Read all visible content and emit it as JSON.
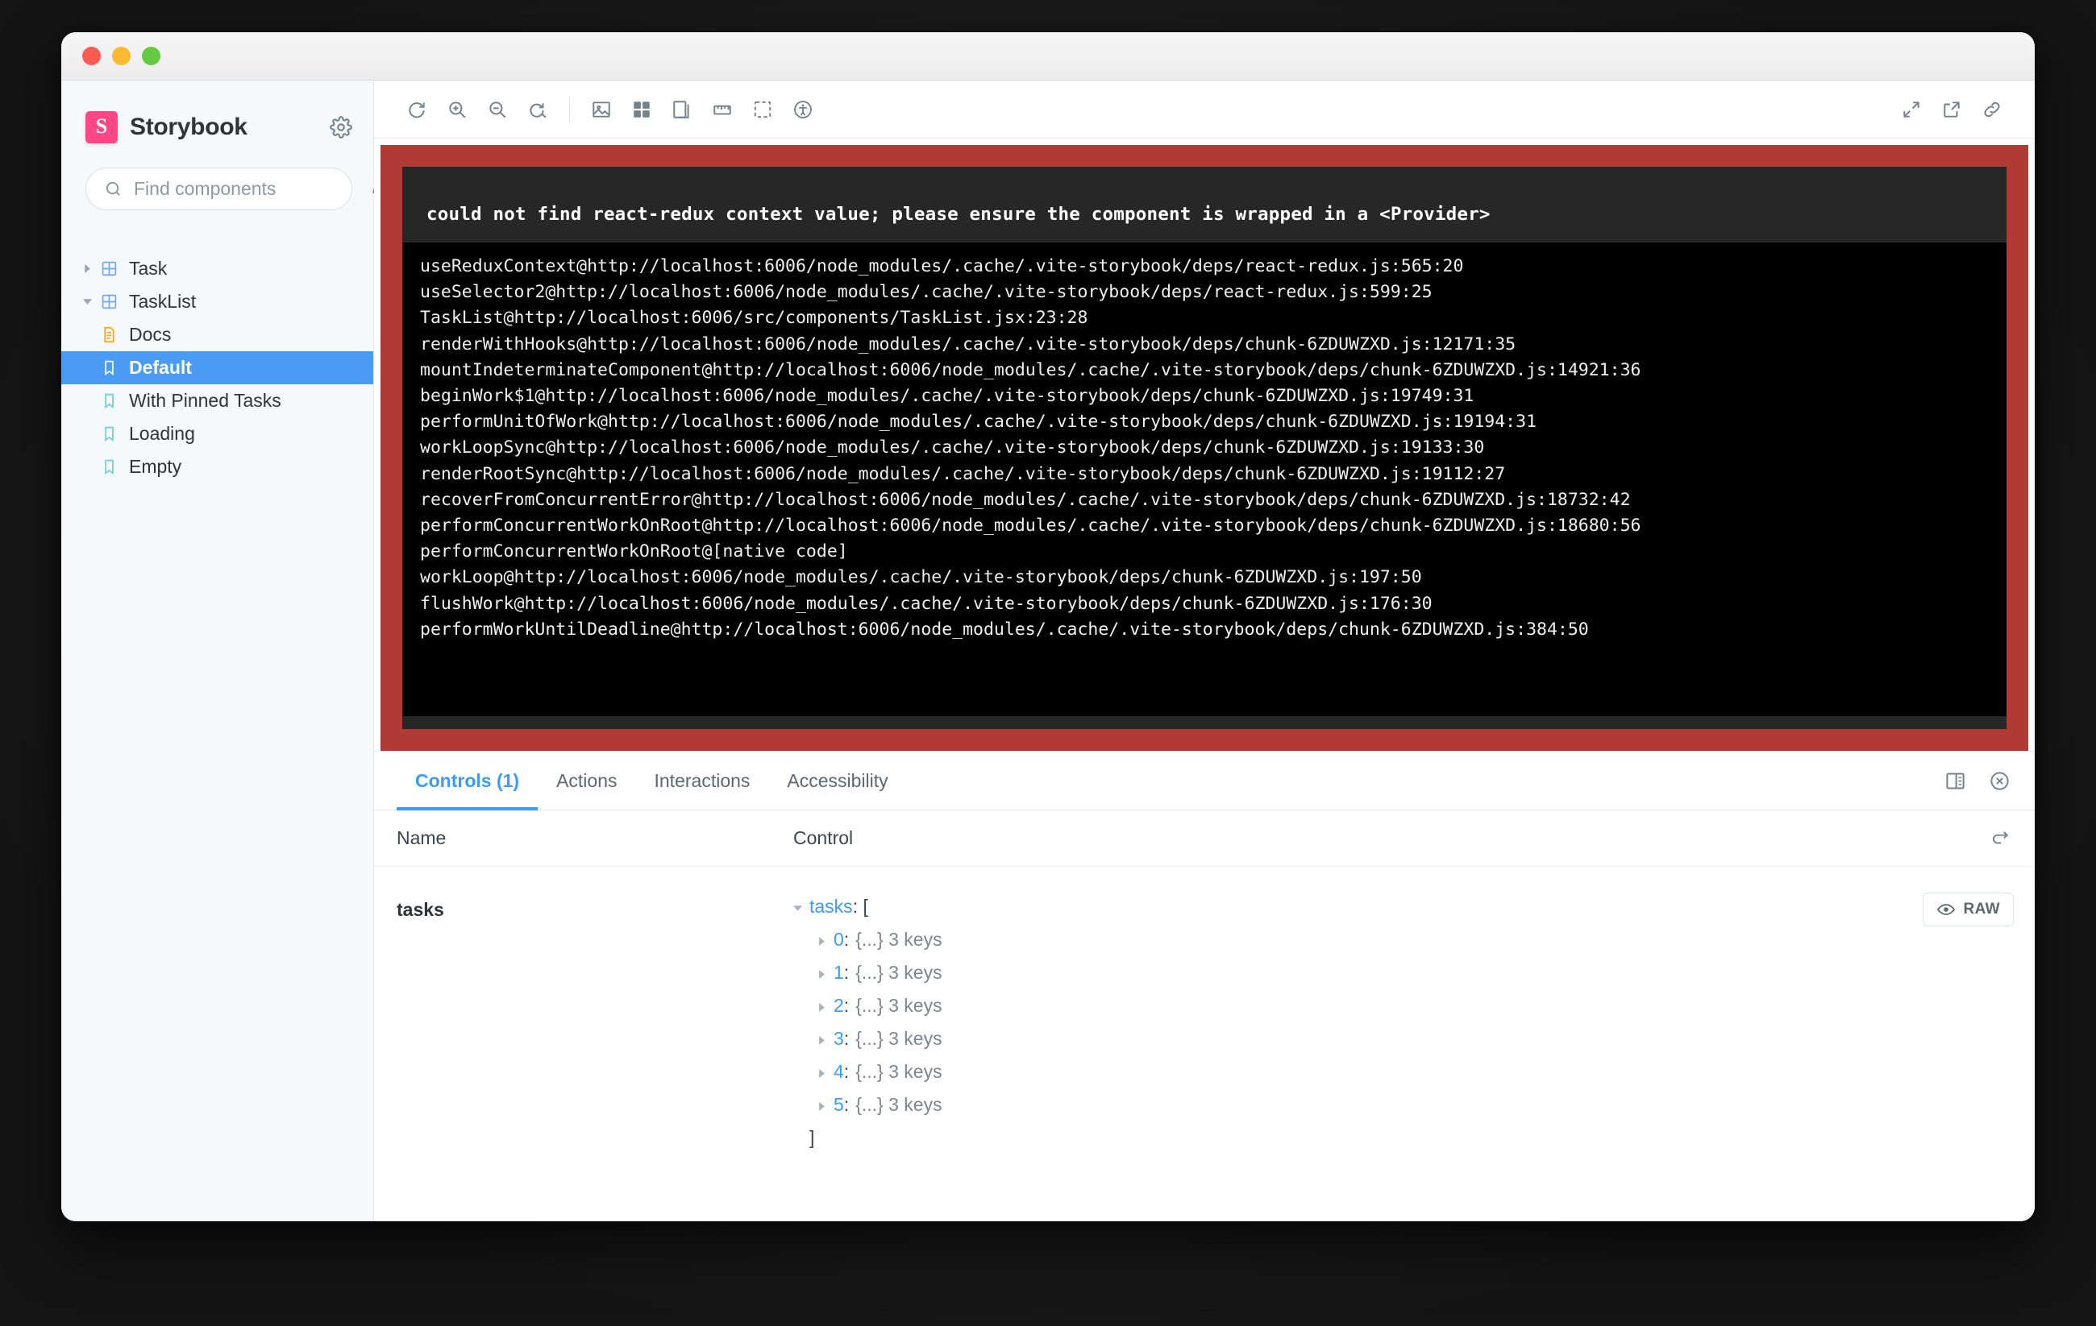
{
  "window": {
    "traffic_lights": [
      "close",
      "minimize",
      "zoom"
    ]
  },
  "sidebar": {
    "brand": "Storybook",
    "logo_letter": "S",
    "settings_icon": "gear-icon",
    "search": {
      "placeholder": "Find components",
      "value": "",
      "shortcut": "/",
      "icon": "search-icon"
    },
    "tree": [
      {
        "label": "Task",
        "icon": "component-icon",
        "depth": 0,
        "caret": "closed",
        "selected": false
      },
      {
        "label": "TaskList",
        "icon": "component-icon",
        "depth": 0,
        "caret": "open",
        "selected": false
      },
      {
        "label": "Docs",
        "icon": "docs-icon",
        "depth": 1,
        "caret": "none",
        "selected": false
      },
      {
        "label": "Default",
        "icon": "story-icon",
        "depth": 1,
        "caret": "none",
        "selected": true
      },
      {
        "label": "With Pinned Tasks",
        "icon": "story-icon",
        "depth": 1,
        "caret": "none",
        "selected": false
      },
      {
        "label": "Loading",
        "icon": "story-icon",
        "depth": 1,
        "caret": "none",
        "selected": false
      },
      {
        "label": "Empty",
        "icon": "story-icon",
        "depth": 1,
        "caret": "none",
        "selected": false
      }
    ]
  },
  "toolbar": {
    "left_icons": [
      "remount-icon",
      "zoom-in-icon",
      "zoom-out-icon",
      "zoom-reset-icon"
    ],
    "tool_icons": [
      "background-image-icon",
      "grid-icon",
      "viewport-icon",
      "measure-icon",
      "outline-icon",
      "accessibility-icon"
    ],
    "right_icons": [
      "fullscreen-icon",
      "open-in-new-tab-icon",
      "copy-link-icon"
    ]
  },
  "preview": {
    "error_title": "could not find react-redux context value; please ensure the component is wrapped in a <Provider>",
    "stack": "useReduxContext@http://localhost:6006/node_modules/.cache/.vite-storybook/deps/react-redux.js:565:20\nuseSelector2@http://localhost:6006/node_modules/.cache/.vite-storybook/deps/react-redux.js:599:25\nTaskList@http://localhost:6006/src/components/TaskList.jsx:23:28\nrenderWithHooks@http://localhost:6006/node_modules/.cache/.vite-storybook/deps/chunk-6ZDUWZXD.js:12171:35\nmountIndeterminateComponent@http://localhost:6006/node_modules/.cache/.vite-storybook/deps/chunk-6ZDUWZXD.js:14921:36\nbeginWork$1@http://localhost:6006/node_modules/.cache/.vite-storybook/deps/chunk-6ZDUWZXD.js:19749:31\nperformUnitOfWork@http://localhost:6006/node_modules/.cache/.vite-storybook/deps/chunk-6ZDUWZXD.js:19194:31\nworkLoopSync@http://localhost:6006/node_modules/.cache/.vite-storybook/deps/chunk-6ZDUWZXD.js:19133:30\nrenderRootSync@http://localhost:6006/node_modules/.cache/.vite-storybook/deps/chunk-6ZDUWZXD.js:19112:27\nrecoverFromConcurrentError@http://localhost:6006/node_modules/.cache/.vite-storybook/deps/chunk-6ZDUWZXD.js:18732:42\nperformConcurrentWorkOnRoot@http://localhost:6006/node_modules/.cache/.vite-storybook/deps/chunk-6ZDUWZXD.js:18680:56\nperformConcurrentWorkOnRoot@[native code]\nworkLoop@http://localhost:6006/node_modules/.cache/.vite-storybook/deps/chunk-6ZDUWZXD.js:197:50\nflushWork@http://localhost:6006/node_modules/.cache/.vite-storybook/deps/chunk-6ZDUWZXD.js:176:30\nperformWorkUntilDeadline@http://localhost:6006/node_modules/.cache/.vite-storybook/deps/chunk-6ZDUWZXD.js:384:50",
    "frame_color": "#b03a36",
    "panel_color": "#272727",
    "stack_bg": "#000000"
  },
  "addons": {
    "tabs": [
      {
        "label": "Controls (1)",
        "active": true
      },
      {
        "label": "Actions",
        "active": false
      },
      {
        "label": "Interactions",
        "active": false
      },
      {
        "label": "Accessibility",
        "active": false
      }
    ],
    "panel_icons": [
      "layout-position-icon",
      "close-panel-icon"
    ],
    "table": {
      "columns": {
        "name": "Name",
        "control": "Control"
      },
      "reset_icon": "reset-controls-icon",
      "rows": [
        {
          "name": "tasks",
          "control_type": "object-tree",
          "root_key": "tasks",
          "open_bracket": ": [",
          "close_bracket": "]",
          "items": [
            {
              "index": "0",
              "separator": ":",
              "value": "{...} 3 keys"
            },
            {
              "index": "1",
              "separator": ":",
              "value": "{...} 3 keys"
            },
            {
              "index": "2",
              "separator": ":",
              "value": "{...} 3 keys"
            },
            {
              "index": "3",
              "separator": ":",
              "value": "{...} 3 keys"
            },
            {
              "index": "4",
              "separator": ":",
              "value": "{...} 3 keys"
            },
            {
              "index": "5",
              "separator": ":",
              "value": "{...} 3 keys"
            }
          ],
          "raw_button": {
            "label": "RAW",
            "icon": "eye-icon"
          }
        }
      ]
    }
  },
  "colors": {
    "accent_blue": "#3d9bf5",
    "selected_blue": "#4a9bf4",
    "brand_pink": "#ff4785",
    "error_red": "#b03a36",
    "sidebar_bg": "#f6f9fc"
  }
}
